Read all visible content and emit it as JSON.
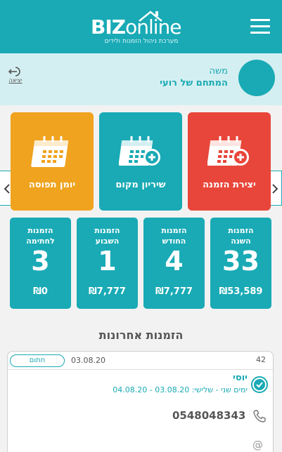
{
  "header": {
    "logo_biz": "BIZ",
    "logo_online": "online",
    "logo_subtitle": "מערכת ניהול הזמנות ולידים"
  },
  "user": {
    "name": "משה",
    "business": "המתחם של רועי",
    "logout_label": "יציאה"
  },
  "actions": [
    {
      "label": "יצירת הזמנה",
      "color": "#e8463a",
      "icon": "calendar-plus-icon"
    },
    {
      "label": "שיריון מקום",
      "color": "#19aab5",
      "icon": "calendar-plus-icon"
    },
    {
      "label": "יומן תפוסה",
      "color": "#f0a31e",
      "icon": "calendar-icon"
    }
  ],
  "stats": [
    {
      "label_line1": "הזמנות",
      "label_line2": "השנה",
      "count": "33",
      "amount": "₪53,589"
    },
    {
      "label_line1": "הזמנות",
      "label_line2": "החודש",
      "count": "4",
      "amount": "₪7,777"
    },
    {
      "label_line1": "הזמנות",
      "label_line2": "השבוע",
      "count": "1",
      "amount": "₪7,777"
    },
    {
      "label_line1": "הזמנות",
      "label_line2": "לחתימה",
      "count": "3",
      "amount": "₪0"
    }
  ],
  "recent": {
    "title": "הזמנות אחרונות",
    "orders": [
      {
        "id": "42",
        "date": "03.08.20",
        "status": "חתום",
        "customer": "יוסי",
        "range": "ימים שני - שלישי: 03.08.20 - 04.08.20",
        "phone": "0548048343"
      }
    ]
  },
  "colors": {
    "primary": "#19aab5",
    "red": "#e8463a",
    "orange": "#f0a31e",
    "strip": "#d4eff1"
  }
}
